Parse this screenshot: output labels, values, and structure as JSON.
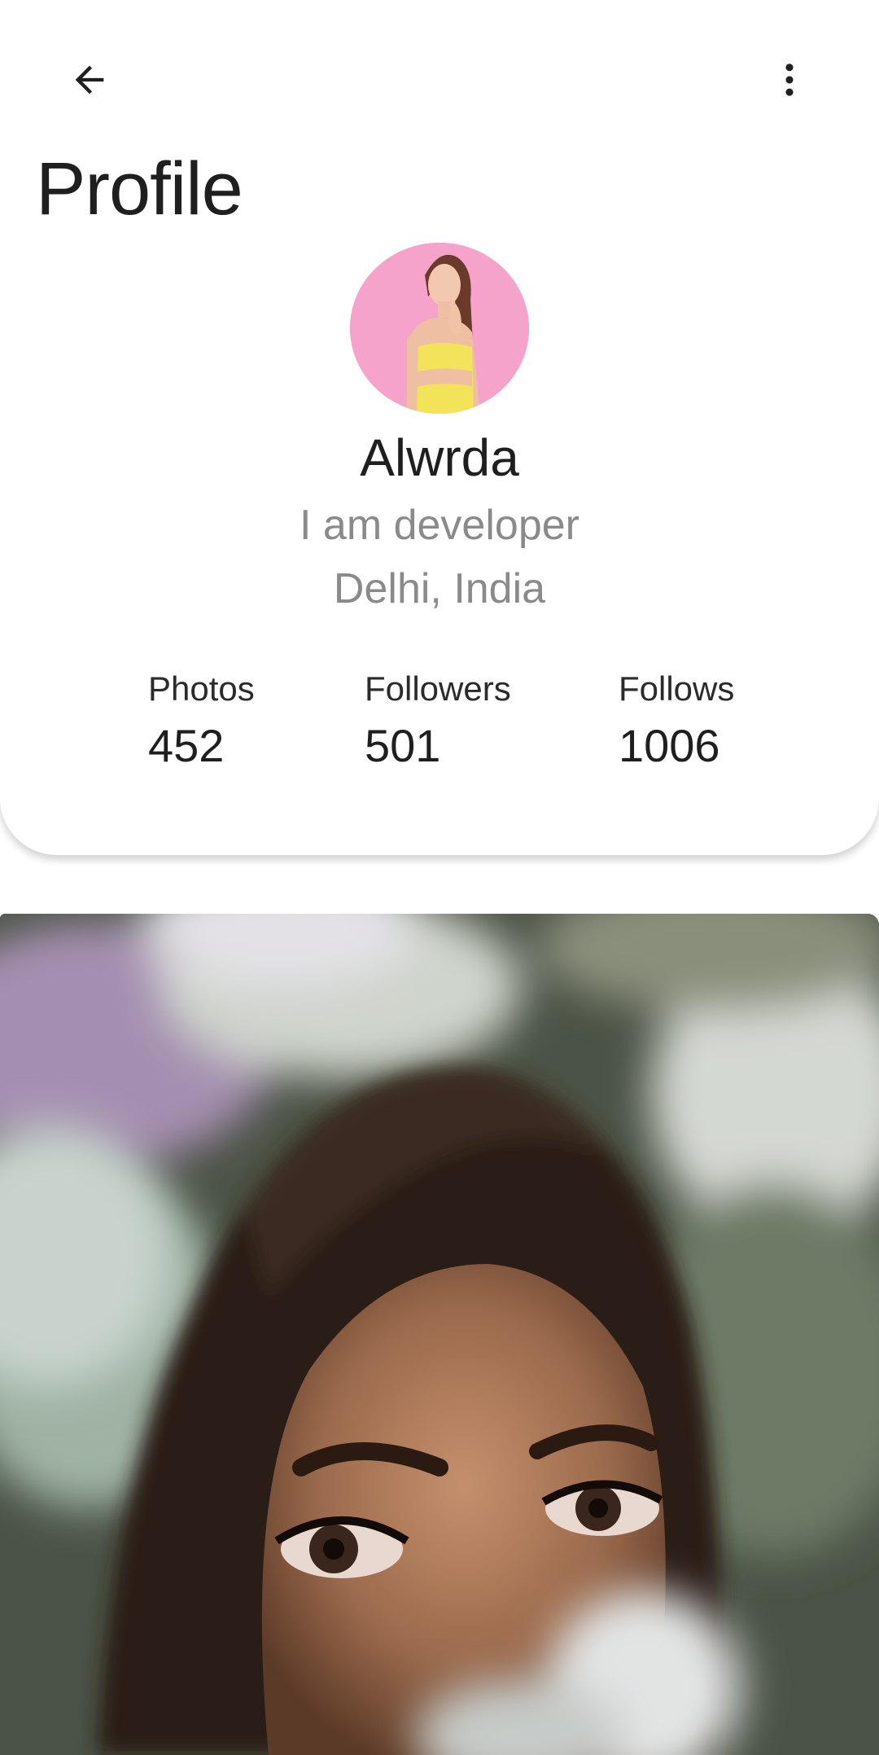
{
  "app_bar": {
    "back_icon": "arrow-left-icon",
    "more_icon": "more-vert-icon",
    "title": "Profile"
  },
  "profile": {
    "avatar_icon": "profile-avatar",
    "avatar_bg": "#f6a3cb",
    "name": "Alwrda",
    "bio": "I am developer",
    "location": "Delhi, India"
  },
  "stats": [
    {
      "label": "Photos",
      "value": "452"
    },
    {
      "label": "Followers",
      "value": "501"
    },
    {
      "label": "Follows",
      "value": "1006"
    }
  ],
  "colors": {
    "title_text": "#1f1f1f",
    "secondary_text": "#8a8a8a",
    "background": "#ffffff"
  }
}
